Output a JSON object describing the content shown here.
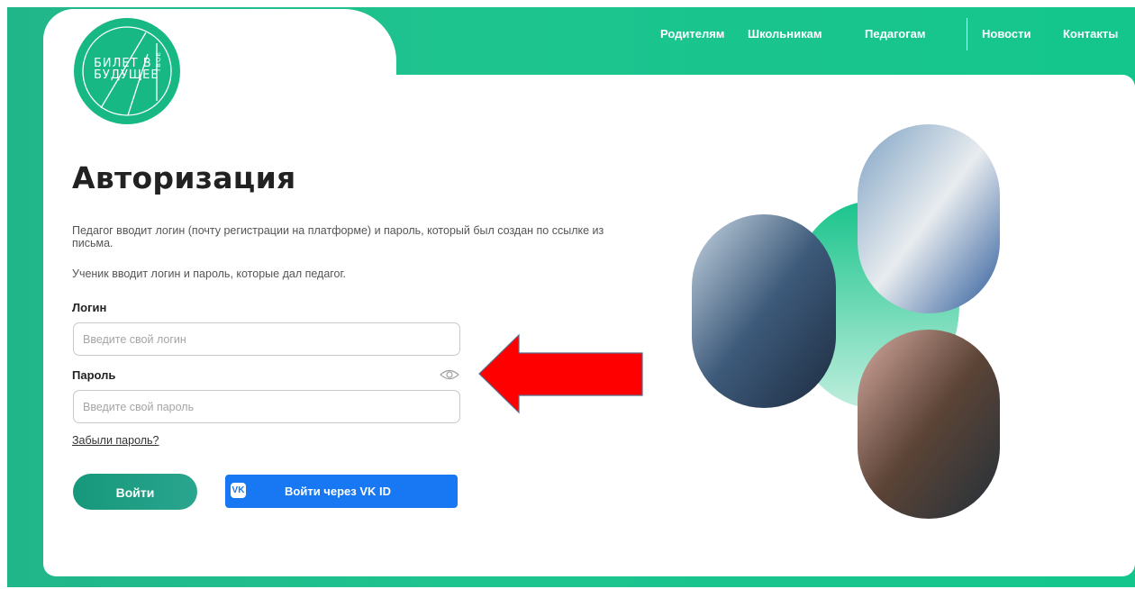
{
  "nav": {
    "items": [
      "Родителям",
      "Школьникам",
      "Педагогам",
      "Новости",
      "Контакты"
    ]
  },
  "logo": {
    "line1": "БИЛЕТ В",
    "line2": "БУДУЩЕЕ",
    "vertical": "ТВОЕ"
  },
  "auth": {
    "title": "Авторизация",
    "desc_teacher": "Педагог вводит логин (почту регистрации на платформе) и пароль, который был создан по ссылке из письма.",
    "desc_student": "Ученик вводит логин и пароль, которые дал педагог.",
    "login_label": "Логин",
    "login_placeholder": "Введите свой логин",
    "login_value": "",
    "password_label": "Пароль",
    "password_placeholder": "Введите свой пароль",
    "password_value": "",
    "forgot": "Забыли пароль?",
    "submit": "Войти",
    "vk_icon_text": "VK",
    "vk_submit": "Войти через VK ID"
  },
  "colors": {
    "brand_green": "#1ec48e",
    "button_green": "#16987b",
    "vk_blue": "#1877f2",
    "annotation_arrow": "#ff0000"
  },
  "icons": [
    "eye-icon",
    "vk-icon",
    "red-arrow-icon"
  ]
}
